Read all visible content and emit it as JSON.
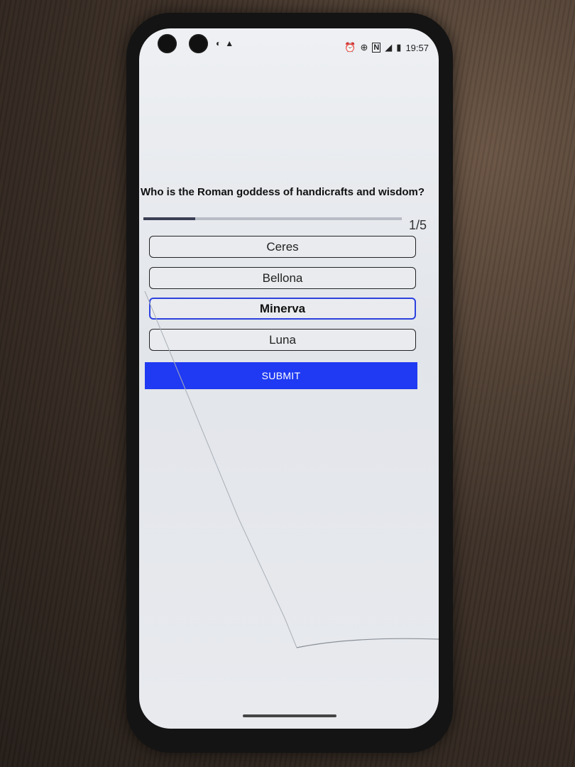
{
  "status_bar": {
    "time": "19:57",
    "left_icons": [
      "notification-icon",
      "warning-icon"
    ],
    "right_icons": [
      "alarm-icon",
      "sync-icon",
      "nfc-icon",
      "signal-icon",
      "battery-icon"
    ]
  },
  "quiz": {
    "question": "Who is the Roman goddess of handicrafts and wisdom?",
    "progress_text": "1/5",
    "progress_fraction": 0.2,
    "options": [
      {
        "label": "Ceres",
        "selected": false
      },
      {
        "label": "Bellona",
        "selected": false
      },
      {
        "label": "Minerva",
        "selected": true
      },
      {
        "label": "Luna",
        "selected": false
      }
    ],
    "submit_label": "SUBMIT"
  },
  "colors": {
    "accent": "#1f3af2",
    "selected_border": "#2c42e0"
  }
}
